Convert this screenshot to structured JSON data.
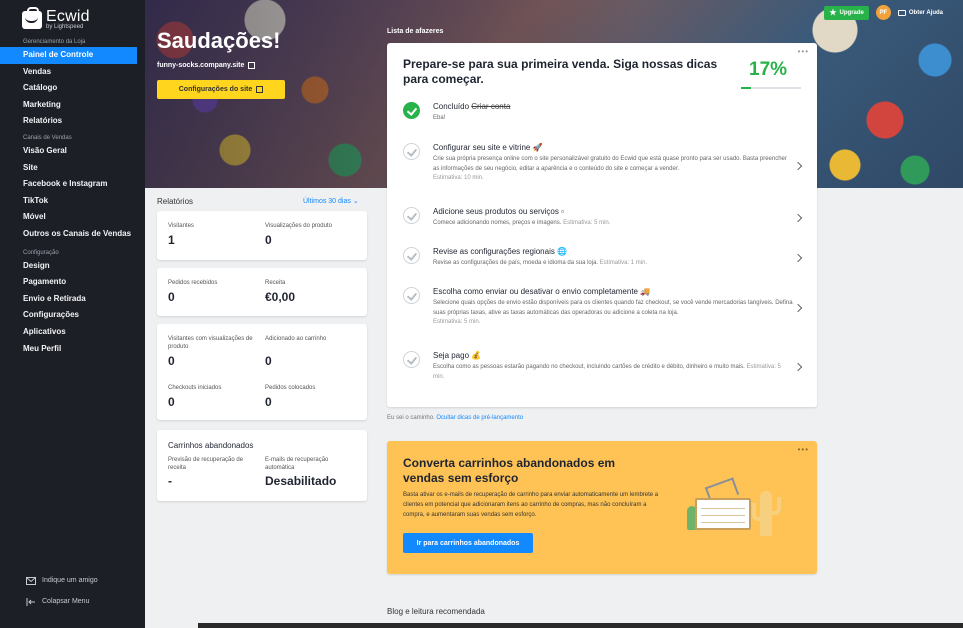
{
  "sidebar": {
    "brand": "Ecwid",
    "brand_sub": "by Lightspeed",
    "section_store": "Gerenciamento da Loja",
    "store_items": [
      "Painel de Controle",
      "Vendas",
      "Catálogo",
      "Marketing",
      "Relatórios"
    ],
    "section_channels": "Canais de Vendas",
    "channel_items": [
      "Visão Geral",
      "Site",
      "Facebook e Instagram",
      "TikTok",
      "Móvel",
      "Outros os Canais de Vendas"
    ],
    "section_config": "Configuração",
    "config_items": [
      "Design",
      "Pagamento",
      "Envio e Retirada",
      "Configurações",
      "Aplicativos",
      "Meu Perfil"
    ],
    "invite": "Indique um amigo",
    "collapse": "Colapsar Menu"
  },
  "topbar": {
    "upgrade": "Upgrade",
    "avatar": "PF",
    "help": "Obter Ajuda"
  },
  "hero": {
    "greeting": "Saudações!",
    "site_url": "funny-socks.company.site",
    "site_button": "Configurações do site"
  },
  "reports": {
    "title": "Relatórios",
    "period": "Últimos 30 dias",
    "visitors_label": "Visitantes",
    "visitors_value": "1",
    "product_views_label": "Visualizações do produto",
    "product_views_value": "0",
    "orders_label": "Pedidos recebidos",
    "orders_value": "0",
    "revenue_label": "Receita",
    "revenue_value": "€0,00",
    "visitors_views_label": "Visitantes com visualizações de produto",
    "visitors_views_value": "0",
    "added_cart_label": "Adicionado ao carrinho",
    "added_cart_value": "0",
    "checkouts_label": "Checkouts iniciados",
    "checkouts_value": "0",
    "placed_label": "Pedidos colocados",
    "placed_value": "0",
    "abandoned_title": "Carrinhos abandonados",
    "forecast_label": "Previsão de recuperação de receita",
    "forecast_value": "-",
    "emails_label": "E-mails de recuperação automática",
    "emails_value": "Desabilitado"
  },
  "todo": {
    "section_title": "Lista de afazeres",
    "heading": "Prepare-se para sua primeira venda. Siga nossas dicas para começar.",
    "percent": "17%",
    "progress": 0.17,
    "tasks": [
      {
        "prefix": "Concluído",
        "title": "Criar conta",
        "desc": "Eba!",
        "est": ""
      },
      {
        "prefix": "",
        "title": "Configurar seu site e vitrine 🚀",
        "desc": "Crie sua própria presença online com o site personalizável gratuito do Ecwid que está quase pronto para ser usado. Basta preencher as informações de seu negócio, editar a aparência e o conteúdo do site e começar a vender.",
        "est": "Estimativa: 10 min."
      },
      {
        "prefix": "",
        "title": "Adicione seus produtos ou serviços ▫",
        "desc": "Comece adicionando nomes, preços e imagens.",
        "est": "Estimativa: 5 min."
      },
      {
        "prefix": "",
        "title": "Revise as configurações regionais 🌐",
        "desc": "Revise as configurações de país, moeda e idioma da sua loja.",
        "est": "Estimativa: 1 min."
      },
      {
        "prefix": "",
        "title": "Escolha como enviar ou desativar o envio completamente 🚚",
        "desc": "Selecione quais opções de envio estão disponíveis para os clientes quando faz checkout, se você vende mercadorias tangíveis. Defina suas próprias taxas, ative as taxas automáticas das operadoras ou adicione a coleta na loja.",
        "est": "Estimativa: 5 min."
      },
      {
        "prefix": "",
        "title": "Seja pago 💰",
        "desc": "Escolha como as pessoas estarão pagando no checkout, incluindo cartões de crédito e débito, dinheiro e muito mais.",
        "est": "Estimativa: 5 min."
      }
    ],
    "hint_prefix": "Eu sei o caminho.",
    "hint_link": "Ocultar dicas de pré-lançamento"
  },
  "promo": {
    "title": "Converta carrinhos abandonados em vendas sem esforço",
    "desc": "Basta ativar os e-mails de recuperação de carrinho para enviar automaticamente um lembrete a clientes em potencial que adicionaram itens ao carrinho de compras, mas não concluíram a compra, e aumentaram suas vendas sem esforço.",
    "button": "Ir para carrinhos abandonados"
  },
  "blog_title": "Blog e leitura recomendada",
  "colors": {
    "accent": "#1389ff",
    "success": "#27b34a",
    "sidebar": "#1d1f26",
    "promo": "#ffc355",
    "site_button": "#ffd51e"
  }
}
